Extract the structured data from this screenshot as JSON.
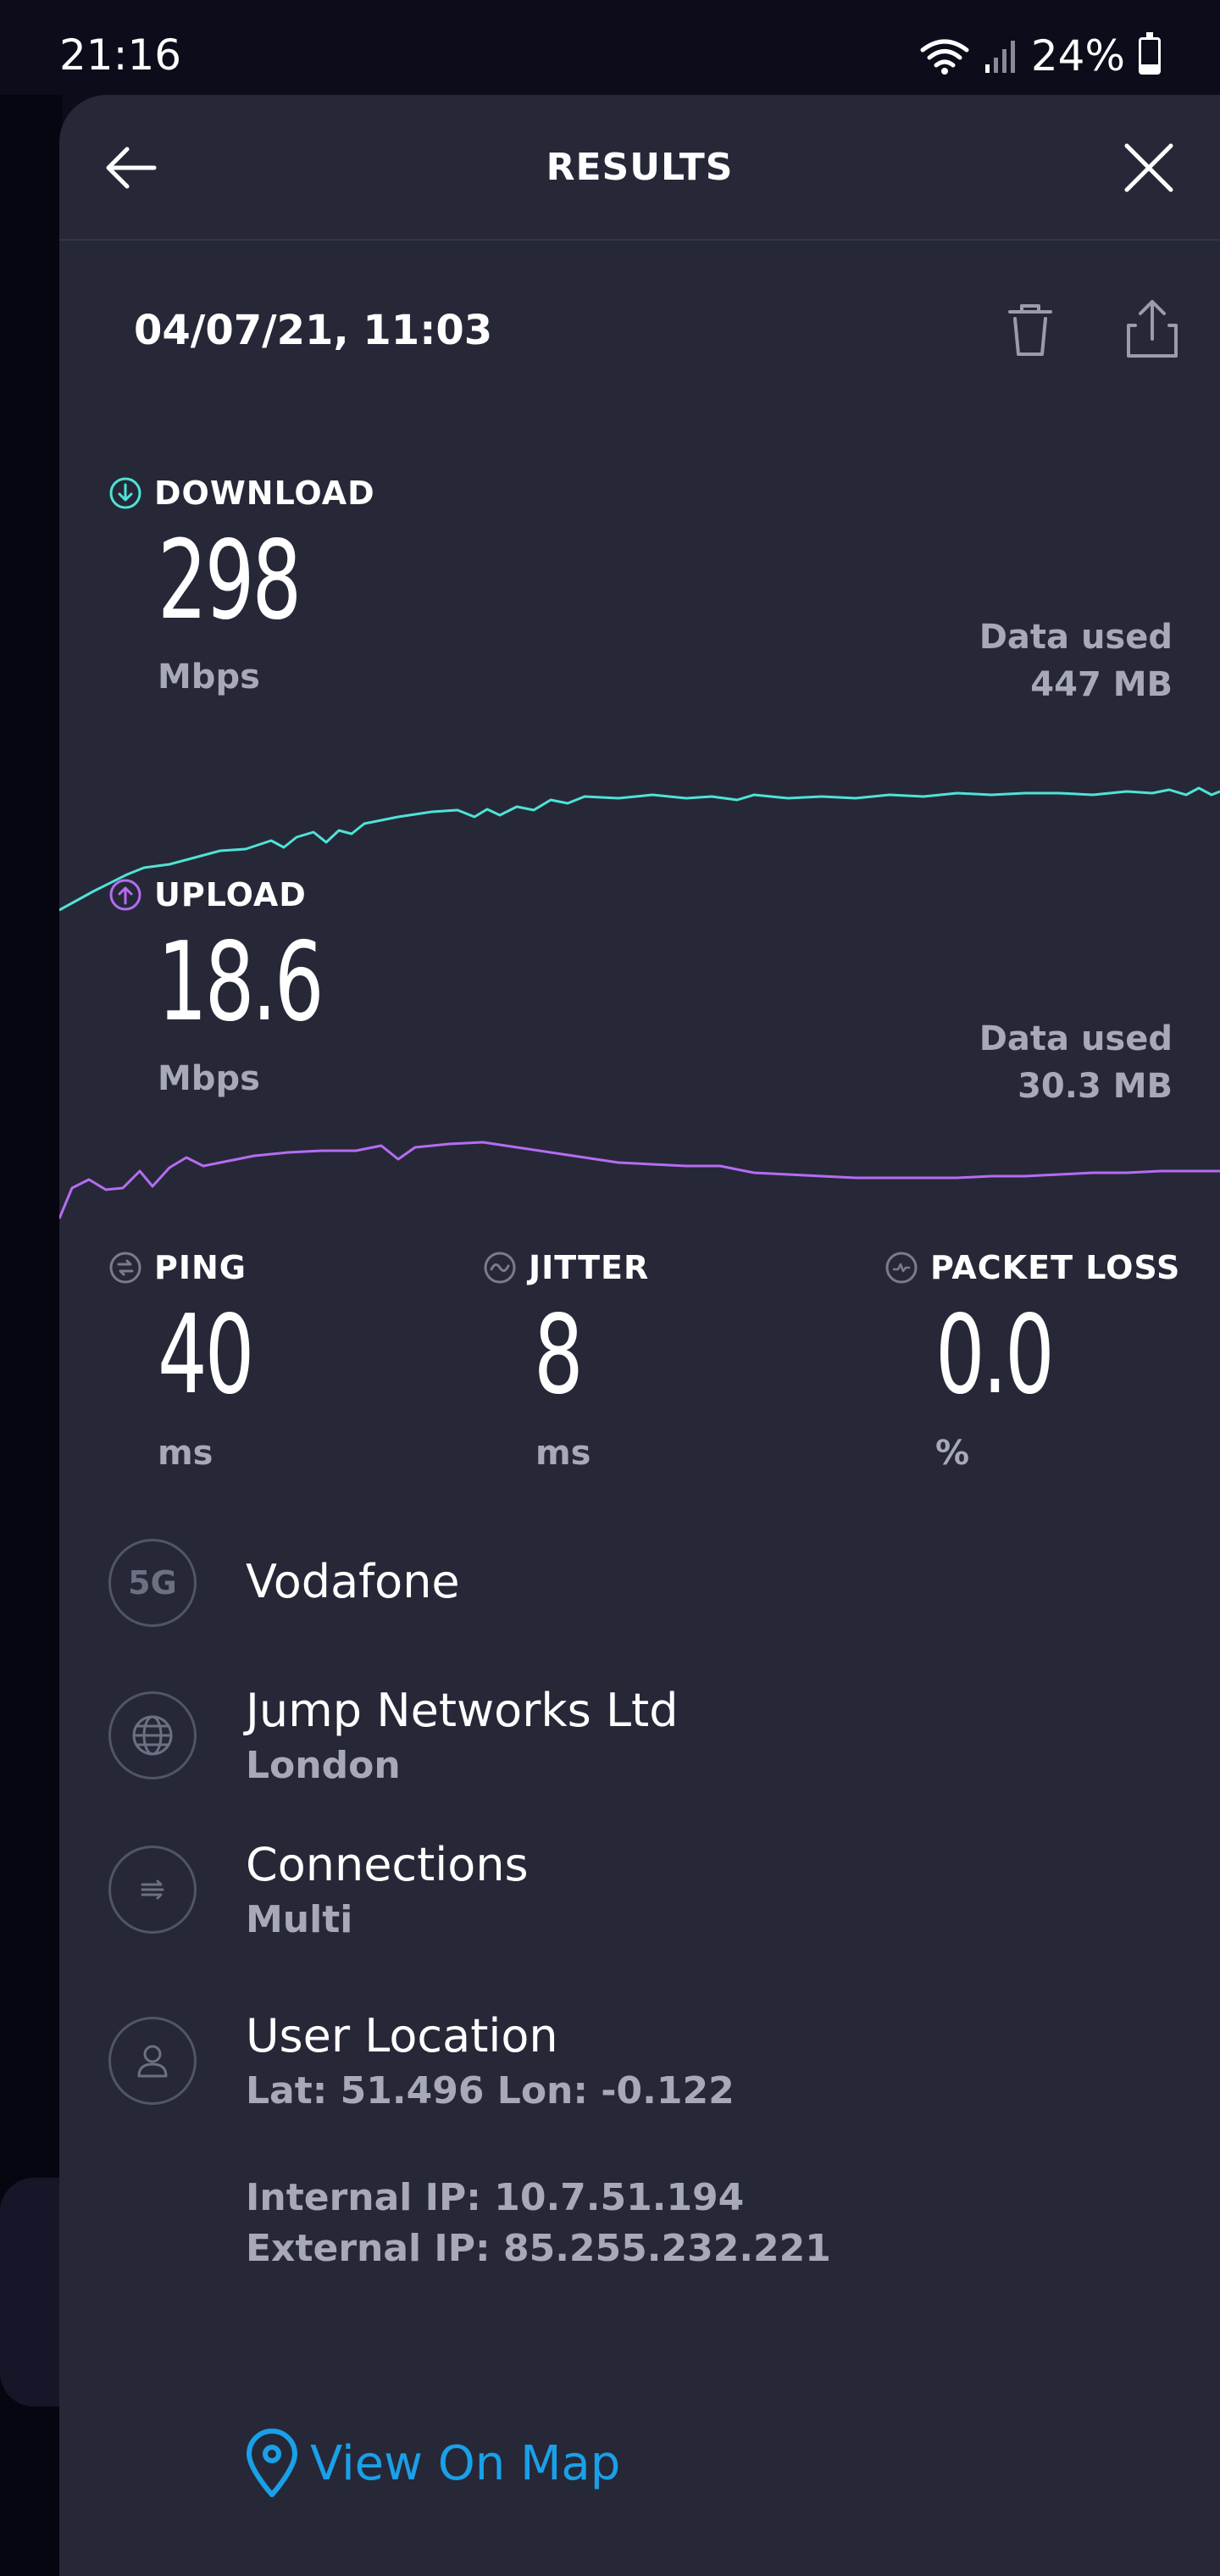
{
  "status_bar": {
    "time": "21:16",
    "battery": "24%",
    "battery_level": 0.24
  },
  "header": {
    "title": "RESULTS"
  },
  "test": {
    "date": "04/07/21, 11:03"
  },
  "download": {
    "label": "DOWNLOAD",
    "value": "298",
    "unit": "Mbps",
    "data_used_label": "Data used",
    "data_used_value": "447 MB",
    "color": "#4fe3d6"
  },
  "upload": {
    "label": "UPLOAD",
    "value": "18.6",
    "unit": "Mbps",
    "data_used_label": "Data used",
    "data_used_value": "30.3 MB",
    "color": "#b56cf2"
  },
  "ping": {
    "label": "PING",
    "value": "40",
    "unit": "ms"
  },
  "jitter": {
    "label": "JITTER",
    "value": "8",
    "unit": "ms"
  },
  "packet_loss": {
    "label": "PACKET LOSS",
    "value": "0.0",
    "unit": "%"
  },
  "provider": {
    "icon_text": "5G",
    "name": "Vodafone"
  },
  "server": {
    "name": "Jump Networks Ltd",
    "city": "London"
  },
  "connections": {
    "label": "Connections",
    "value": "Multi"
  },
  "user_location": {
    "label": "User Location",
    "coords": "Lat: 51.496 Lon: -0.122"
  },
  "ips": {
    "internal": "Internal IP: 10.7.51.194",
    "external": "External IP: 85.255.232.221"
  },
  "map": {
    "label": "View On Map",
    "color": "#1aa0e8"
  }
}
